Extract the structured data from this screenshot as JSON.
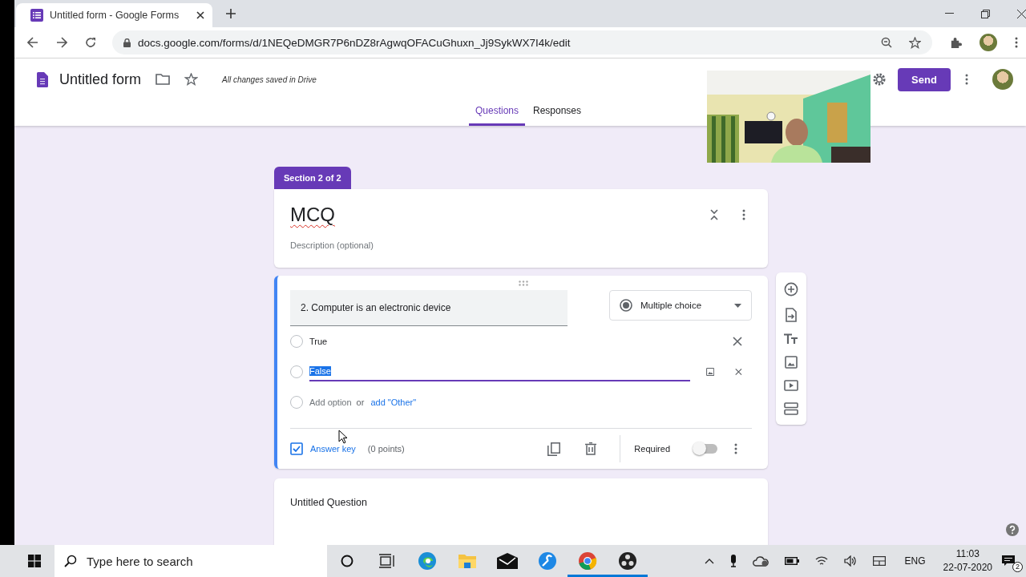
{
  "browser": {
    "tab_title": "Untitled form - Google Forms",
    "url": "docs.google.com/forms/d/1NEQeDMGR7P6nDZ8rAgwqOFACuGhuxn_Jj9SykWX7I4k/edit"
  },
  "form_header": {
    "title": "Untitled form",
    "save_status": "All changes saved in Drive",
    "send_label": "Send"
  },
  "tabs": [
    {
      "label": "Questions",
      "selected": true
    },
    {
      "label": "Responses",
      "selected": false
    }
  ],
  "section": {
    "badge": "Section 2 of 2",
    "title": "MCQ",
    "description_placeholder": "Description (optional)"
  },
  "question": {
    "text": "2. Computer is an electronic device",
    "type": "Multiple choice",
    "options": [
      {
        "label": "True",
        "editing": false,
        "checked": false
      },
      {
        "label": "False",
        "editing": true,
        "checked": false
      }
    ],
    "add_option_checked": false,
    "add_option": "Add option",
    "or": "or",
    "add_other": "add \"Other\"",
    "answer_key": "Answer key",
    "points": "(0 points)",
    "required_label": "Required",
    "required": false
  },
  "next_question": {
    "title": "Untitled Question"
  },
  "taskbar": {
    "search_placeholder": "Type here to search",
    "apps": [
      {
        "kind": "cortana",
        "active": false
      },
      {
        "kind": "taskview",
        "active": false
      },
      {
        "kind": "edge",
        "active": false
      },
      {
        "kind": "explorer",
        "active": false
      },
      {
        "kind": "mail",
        "active": false
      },
      {
        "kind": "tool",
        "active": false
      },
      {
        "kind": "chrome",
        "active": true
      },
      {
        "kind": "obs",
        "active": true
      }
    ],
    "language": "ENG",
    "time": "11:03",
    "date": "22-07-2020",
    "notifications": "2"
  }
}
